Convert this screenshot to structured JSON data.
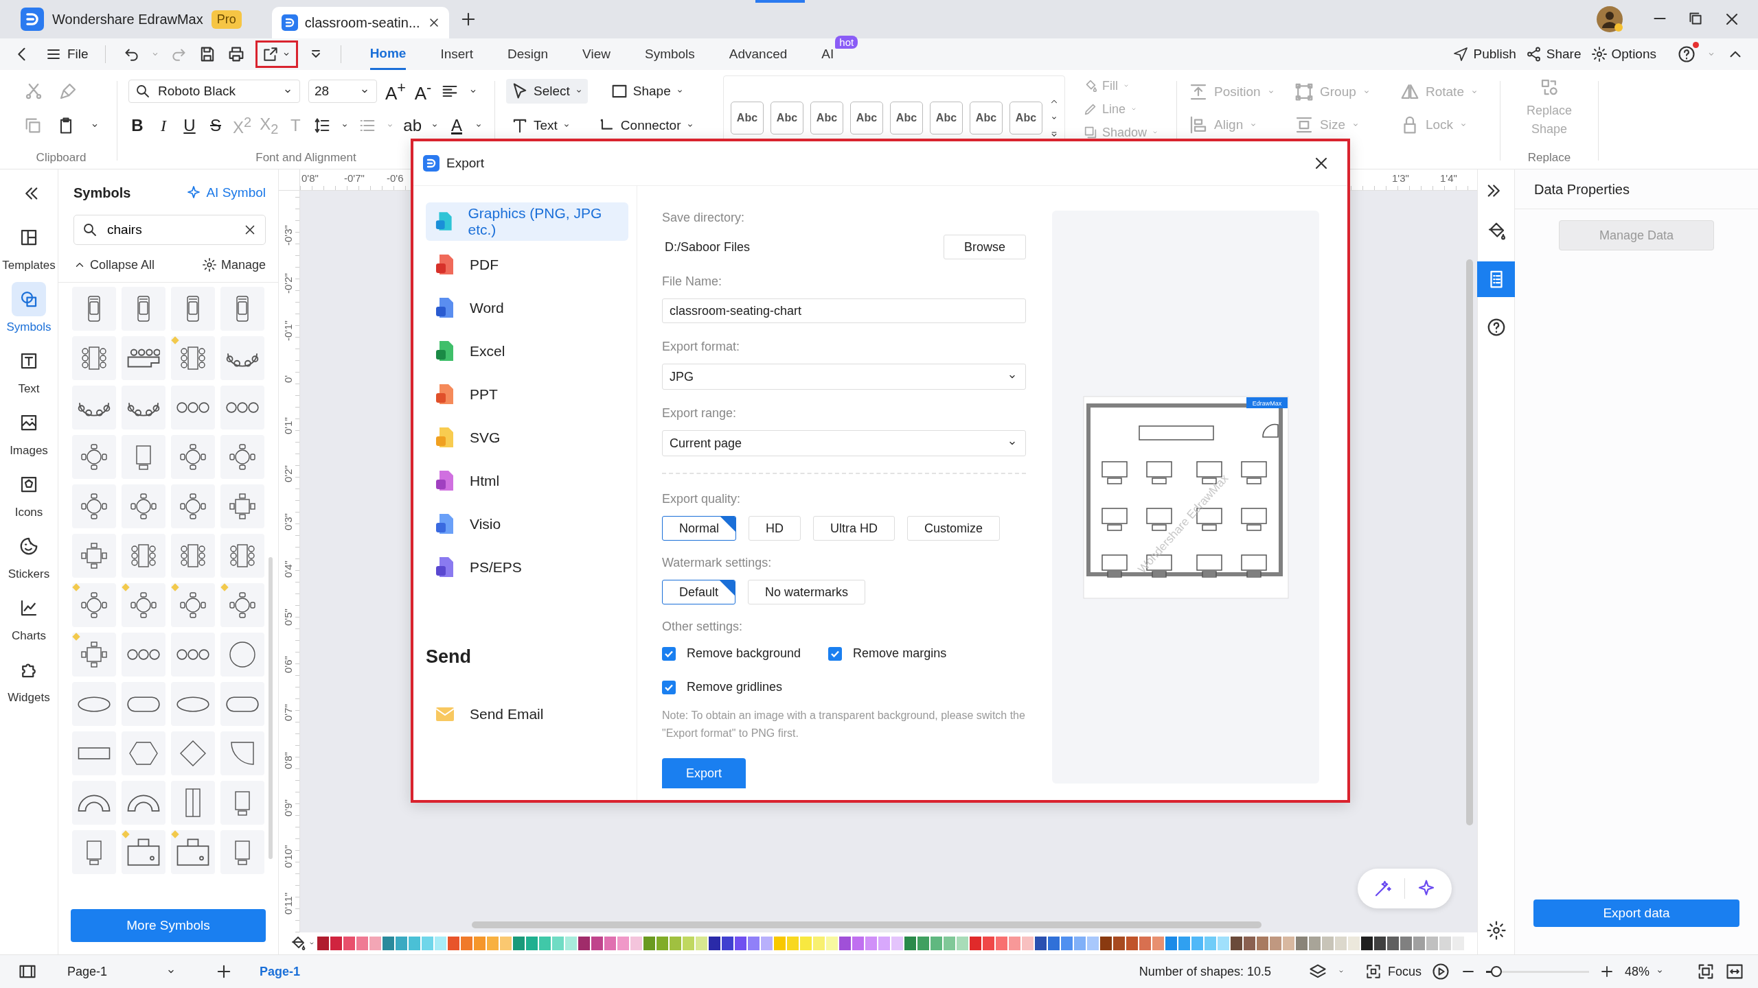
{
  "title_bar": {
    "app_tab": "Wondershare EdrawMax",
    "pro_badge": "Pro",
    "doc_tab": "classroom-seatin..."
  },
  "menu": {
    "file": "File",
    "tabs": [
      {
        "label": "Home",
        "selected": true
      },
      {
        "label": "Insert",
        "selected": false
      },
      {
        "label": "Design",
        "selected": false
      },
      {
        "label": "View",
        "selected": false
      },
      {
        "label": "Symbols",
        "selected": false
      },
      {
        "label": "Advanced",
        "selected": false
      },
      {
        "label": "AI",
        "selected": false,
        "badge": "hot"
      }
    ],
    "actions": [
      "Publish",
      "Share",
      "Options"
    ]
  },
  "ribbon": {
    "font": "Roboto Black",
    "font_size": "28",
    "grow": "A$^{+}$",
    "shrink": "A$^{-}$",
    "format_buttons": [
      {
        "label": "B",
        "kind": "bold"
      },
      {
        "label": "I",
        "kind": "italic"
      },
      {
        "label": "U",
        "kind": "underline"
      },
      {
        "label": "S",
        "kind": "strike"
      },
      {
        "label": "X$^{2}$",
        "kind": "dim"
      },
      {
        "label": "X$_{2}$",
        "kind": "dim"
      },
      {
        "label": "T",
        "kind": "dim"
      }
    ],
    "highlight": "ab",
    "font_color": "A",
    "clipboard_label": "Clipboard",
    "font_label": "Font and Alignment",
    "select": "Select",
    "shape": "Shape",
    "text": "Text",
    "connector": "Connector",
    "styles": [
      "Abc",
      "Abc",
      "Abc",
      "Abc",
      "Abc",
      "Abc",
      "Abc",
      "Abc"
    ],
    "fill": "Fill",
    "line": "Line",
    "shadow": "Shadow",
    "position": "Position",
    "align": "Align",
    "group": "Group",
    "size": "Size",
    "rotate": "Rotate",
    "lock": "Lock",
    "replace_shape": "Replace Shape",
    "replace_label": "Replace"
  },
  "left_rail": [
    {
      "label": "Templates",
      "selected": false
    },
    {
      "label": "Symbols",
      "selected": true
    },
    {
      "label": "Text",
      "selected": false
    },
    {
      "label": "Images",
      "selected": false
    },
    {
      "label": "Icons",
      "selected": false
    },
    {
      "label": "Stickers",
      "selected": false
    },
    {
      "label": "Charts",
      "selected": false
    },
    {
      "label": "Widgets",
      "selected": false
    }
  ],
  "symbols_panel": {
    "title": "Symbols",
    "ai_symbol": "AI Symbol",
    "search": {
      "value": "chairs"
    },
    "collapse": "Collapse All",
    "manage": "Manage",
    "more": "More Symbols",
    "symbols": [
      {
        "premium": false
      },
      {
        "premium": false
      },
      {
        "premium": false
      },
      {
        "premium": false
      },
      {
        "premium": false
      },
      {
        "premium": false
      },
      {
        "premium": true
      },
      {
        "premium": false
      },
      {
        "premium": false
      },
      {
        "premium": false
      },
      {
        "premium": false
      },
      {
        "premium": false
      },
      {
        "premium": false
      },
      {
        "premium": false
      },
      {
        "premium": false
      },
      {
        "premium": false
      },
      {
        "premium": false
      },
      {
        "premium": false
      },
      {
        "premium": false
      },
      {
        "premium": false
      },
      {
        "premium": false
      },
      {
        "premium": false
      },
      {
        "premium": false
      },
      {
        "premium": false
      },
      {
        "premium": true
      },
      {
        "premium": true
      },
      {
        "premium": true
      },
      {
        "premium": true
      },
      {
        "premium": true
      },
      {
        "premium": false
      },
      {
        "premium": false
      },
      {
        "premium": false
      },
      {
        "premium": false
      },
      {
        "premium": false
      },
      {
        "premium": false
      },
      {
        "premium": false
      },
      {
        "premium": false
      },
      {
        "premium": false
      },
      {
        "premium": false
      },
      {
        "premium": false
      },
      {
        "premium": false
      },
      {
        "premium": false
      },
      {
        "premium": false
      },
      {
        "premium": false
      },
      {
        "premium": false
      },
      {
        "premium": true
      },
      {
        "premium": true
      },
      {
        "premium": false
      }
    ]
  },
  "rulers": {
    "top": [
      "0'8\"",
      "-0'7\"",
      "-0'6"
    ],
    "top_right": [
      "1'3\"",
      "1'4\""
    ],
    "left": [
      "-0'3\"",
      "-0'2\"",
      "-0'1\"",
      "0'",
      "0'1\"",
      "0'2\"",
      "0'3\"",
      "0'4\"",
      "0'5\"",
      "0'6\"",
      "0'7\"",
      "0'8\"",
      "0'9\"",
      "0'10\"",
      "0'11\""
    ]
  },
  "dialog": {
    "title": "Export",
    "formats": [
      {
        "label": "Graphics (PNG, JPG etc.)",
        "kind": "image",
        "selected": true
      },
      {
        "label": "PDF",
        "kind": "pdf",
        "selected": false
      },
      {
        "label": "Word",
        "kind": "word",
        "selected": false
      },
      {
        "label": "Excel",
        "kind": "excel",
        "selected": false
      },
      {
        "label": "PPT",
        "kind": "ppt",
        "selected": false
      },
      {
        "label": "SVG",
        "kind": "svg",
        "selected": false
      },
      {
        "label": "Html",
        "kind": "html",
        "selected": false
      },
      {
        "label": "Visio",
        "kind": "visio",
        "selected": false
      },
      {
        "label": "PS/EPS",
        "kind": "ps",
        "selected": false
      }
    ],
    "send_heading": "Send",
    "send_email": "Send Email",
    "save_directory": {
      "label": "Save directory:",
      "value": "D:/Saboor Files",
      "button": "Browse"
    },
    "file_name": {
      "label": "File Name:",
      "value": "classroom-seating-chart"
    },
    "export_format": {
      "label": "Export format:",
      "value": "JPG"
    },
    "export_range": {
      "label": "Export range:",
      "value": "Current page"
    },
    "quality": {
      "label": "Export quality:",
      "options": [
        {
          "label": "Normal",
          "selected": true
        },
        {
          "label": "HD",
          "selected": false
        },
        {
          "label": "Ultra HD",
          "selected": false
        },
        {
          "label": "Customize",
          "selected": false
        }
      ]
    },
    "watermark": {
      "label": "Watermark settings:",
      "options": [
        {
          "label": "Default",
          "selected": true
        },
        {
          "label": "No watermarks",
          "selected": false
        }
      ]
    },
    "other": {
      "label": "Other settings:",
      "settings": [
        {
          "label": "Remove background",
          "checked": true
        },
        {
          "label": "Remove margins",
          "checked": true
        },
        {
          "label": "Remove gridlines",
          "checked": true
        }
      ]
    },
    "note": "Note: To obtain an image with a transparent background, please switch the \"Export format\" to PNG first.",
    "export_button": "Export",
    "preview": {
      "badge": "EdrawMax",
      "watermark": "Wondershare EdrawMax"
    }
  },
  "right_rail": [
    {
      "selected": false
    },
    {
      "selected": true
    },
    {
      "selected": false
    }
  ],
  "right_panel": {
    "title": "Data Properties",
    "manage_data": {
      "label": "Manage Data",
      "disabled": true
    },
    "export_data": "Export data"
  },
  "palette": [
    {
      "color": "#b01c2e"
    },
    {
      "color": "#d0243f"
    },
    {
      "color": "#e8506c"
    },
    {
      "color": "#ef7a93"
    },
    {
      "color": "#f3a6b5"
    },
    {
      "color": "#2a8a9c"
    },
    {
      "color": "#3aaac2"
    },
    {
      "color": "#4ac0d6"
    },
    {
      "color": "#6fd6ea"
    },
    {
      "color": "#a8ecf7"
    },
    {
      "color": "#e8542a"
    },
    {
      "color": "#f07a2a"
    },
    {
      "color": "#f5962a"
    },
    {
      "color": "#f8b040"
    },
    {
      "color": "#fac870"
    },
    {
      "color": "#1a9a7a"
    },
    {
      "color": "#20b090"
    },
    {
      "color": "#40c8a8"
    },
    {
      "color": "#70dcc4"
    },
    {
      "color": "#a8ecdc"
    },
    {
      "color": "#a02c6a"
    },
    {
      "color": "#c0448c"
    },
    {
      "color": "#e070b0"
    },
    {
      "color": "#f098c8"
    },
    {
      "color": "#f4c4dc"
    },
    {
      "color": "#6a9a20"
    },
    {
      "color": "#80ac28"
    },
    {
      "color": "#a0c040"
    },
    {
      "color": "#c0d860"
    },
    {
      "color": "#d8e890"
    },
    {
      "color": "#2a2aa8"
    },
    {
      "color": "#4040d0"
    },
    {
      "color": "#7050f0"
    },
    {
      "color": "#9080f8"
    },
    {
      "color": "#b8b0fc"
    },
    {
      "color": "#f8c800"
    },
    {
      "color": "#f8d820"
    },
    {
      "color": "#f8e840"
    },
    {
      "color": "#f8f070"
    },
    {
      "color": "#f8f8a0"
    },
    {
      "color": "#a050d8"
    },
    {
      "color": "#c070f0"
    },
    {
      "color": "#d090f8"
    },
    {
      "color": "#d8a8fc"
    },
    {
      "color": "#e4c4fc"
    },
    {
      "color": "#2a8a4a"
    },
    {
      "color": "#40a060"
    },
    {
      "color": "#60b880"
    },
    {
      "color": "#80c898"
    },
    {
      "color": "#a8dcb8"
    },
    {
      "color": "#e02a2a"
    },
    {
      "color": "#f04848"
    },
    {
      "color": "#f87070"
    },
    {
      "color": "#f89898"
    },
    {
      "color": "#f8c0c0"
    },
    {
      "color": "#2a50b0"
    },
    {
      "color": "#3070d8"
    },
    {
      "color": "#5090f0"
    },
    {
      "color": "#80b0f8"
    },
    {
      "color": "#a8c8fc"
    },
    {
      "color": "#8a3a10"
    },
    {
      "color": "#a84a20"
    },
    {
      "color": "#c0542a"
    },
    {
      "color": "#d87050"
    },
    {
      "color": "#e89070"
    },
    {
      "color": "#1a8ae8"
    },
    {
      "color": "#30a0f0"
    },
    {
      "color": "#50b8f8"
    },
    {
      "color": "#70ccf8"
    },
    {
      "color": "#a0e0fc"
    },
    {
      "color": "#6a4a3a"
    },
    {
      "color": "#8a6050"
    },
    {
      "color": "#a87a60"
    },
    {
      "color": "#c09880"
    },
    {
      "color": "#d8b8a0"
    },
    {
      "color": "#8a8478"
    },
    {
      "color": "#a8a498"
    },
    {
      "color": "#c8c4b8"
    },
    {
      "color": "#dcd8cc"
    },
    {
      "color": "#ece8dc"
    },
    {
      "color": "#202020"
    },
    {
      "color": "#404040"
    },
    {
      "color": "#606060"
    },
    {
      "color": "#808080"
    },
    {
      "color": "#a0a0a0"
    },
    {
      "color": "#c0c0c0"
    },
    {
      "color": "#d8d8d8"
    },
    {
      "color": "#ececec"
    }
  ],
  "status_bar": {
    "page_select": "Page-1",
    "page_tab": "Page-1",
    "shapes": "Number of shapes: 10.5",
    "focus": "Focus",
    "zoom": {
      "level": 0.1
    },
    "zoom_value": "48%"
  }
}
